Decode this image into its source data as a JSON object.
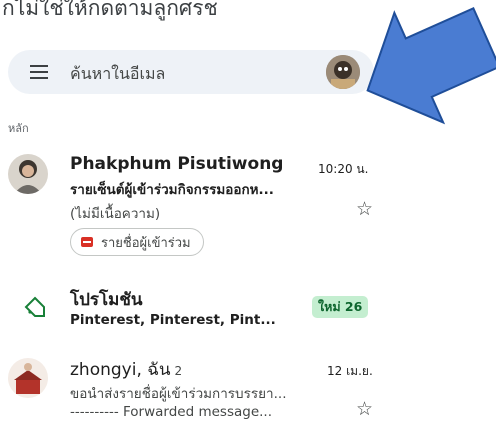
{
  "caption": "กไม่ใช่ให้กดตามลูกศรช",
  "search": {
    "placeholder": "ค้นหาในอีเมล"
  },
  "section_label": "หลัก",
  "colors": {
    "search_bg": "#eef2f7",
    "badge_bg": "#c4eed0",
    "badge_text": "#0d652d",
    "arrow_fill": "#4a7cd2",
    "arrow_stroke": "#1f4e99"
  },
  "emails": [
    {
      "sender": "Phakphum Pisutiwong",
      "time": "10:20 น.",
      "subject": "รายเซ็นต์ผู้เข้าร่วมกิจกรรมออกห...",
      "snippet": "(ไม่มีเนื้อความ)",
      "attachment": "รายชื่อผู้เข้าร่วม"
    },
    {
      "sender": "โปรโมชัน",
      "subject": "Pinterest, Pinterest, Pint...",
      "badge": "ใหม่ 26"
    },
    {
      "sender": "zhongyi, ฉัน",
      "count": "2",
      "time": "12 เม.ย.",
      "subject": "ขอนำส่งรายชื่อผู้เข้าร่วมการบรรยา...",
      "snippet": "---------- Forwarded message..."
    }
  ]
}
